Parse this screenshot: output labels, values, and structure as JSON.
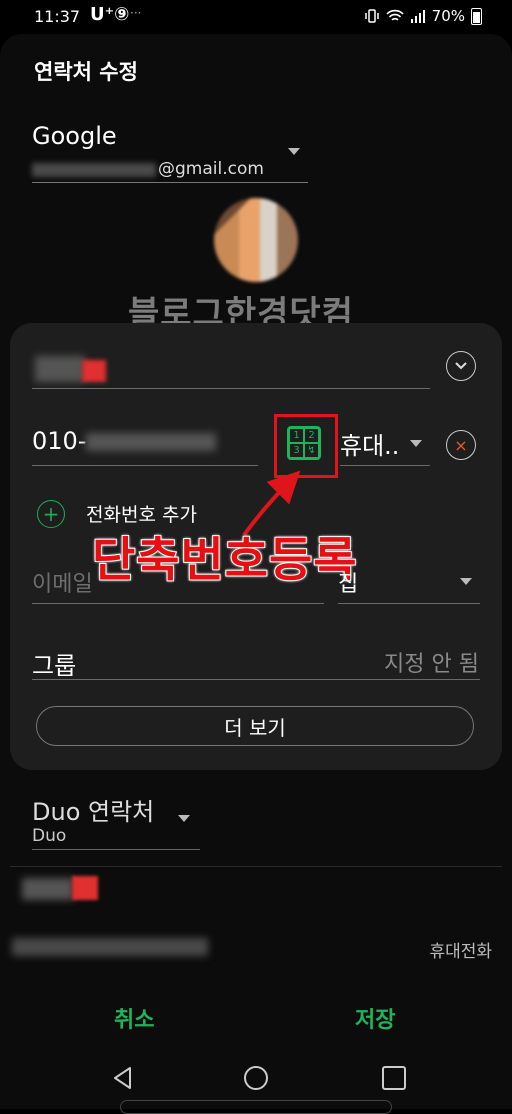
{
  "status_bar": {
    "time": "11:37",
    "carrier": "U⁺⑨",
    "more": "···",
    "battery": "70%"
  },
  "page": {
    "title": "연락처 수정"
  },
  "account": {
    "name": "Google",
    "email_suffix": "@gmail.com"
  },
  "watermark": "블로그한경닷컴",
  "phone": {
    "prefix": "010-",
    "speed_dial_digits": [
      "1",
      "2",
      "3",
      "↯"
    ],
    "type": "휴대..",
    "remove": "×"
  },
  "add_phone": {
    "icon": "+",
    "label": "전화번호 추가"
  },
  "annotation": "단축번호등록",
  "email": {
    "placeholder": "이메일",
    "type": "집"
  },
  "group": {
    "label": "그룹",
    "value": "지정 안 됨"
  },
  "more_button": "더 보기",
  "duo": {
    "title": "Duo 연락처",
    "subtitle": "Duo"
  },
  "linked_contact": {
    "type": "휴대전화"
  },
  "actions": {
    "cancel": "취소",
    "save": "저장"
  },
  "colors": {
    "accent_green": "#1fb35a",
    "annotation_red": "#e60f12",
    "card_bg": "#1e1e1e"
  }
}
